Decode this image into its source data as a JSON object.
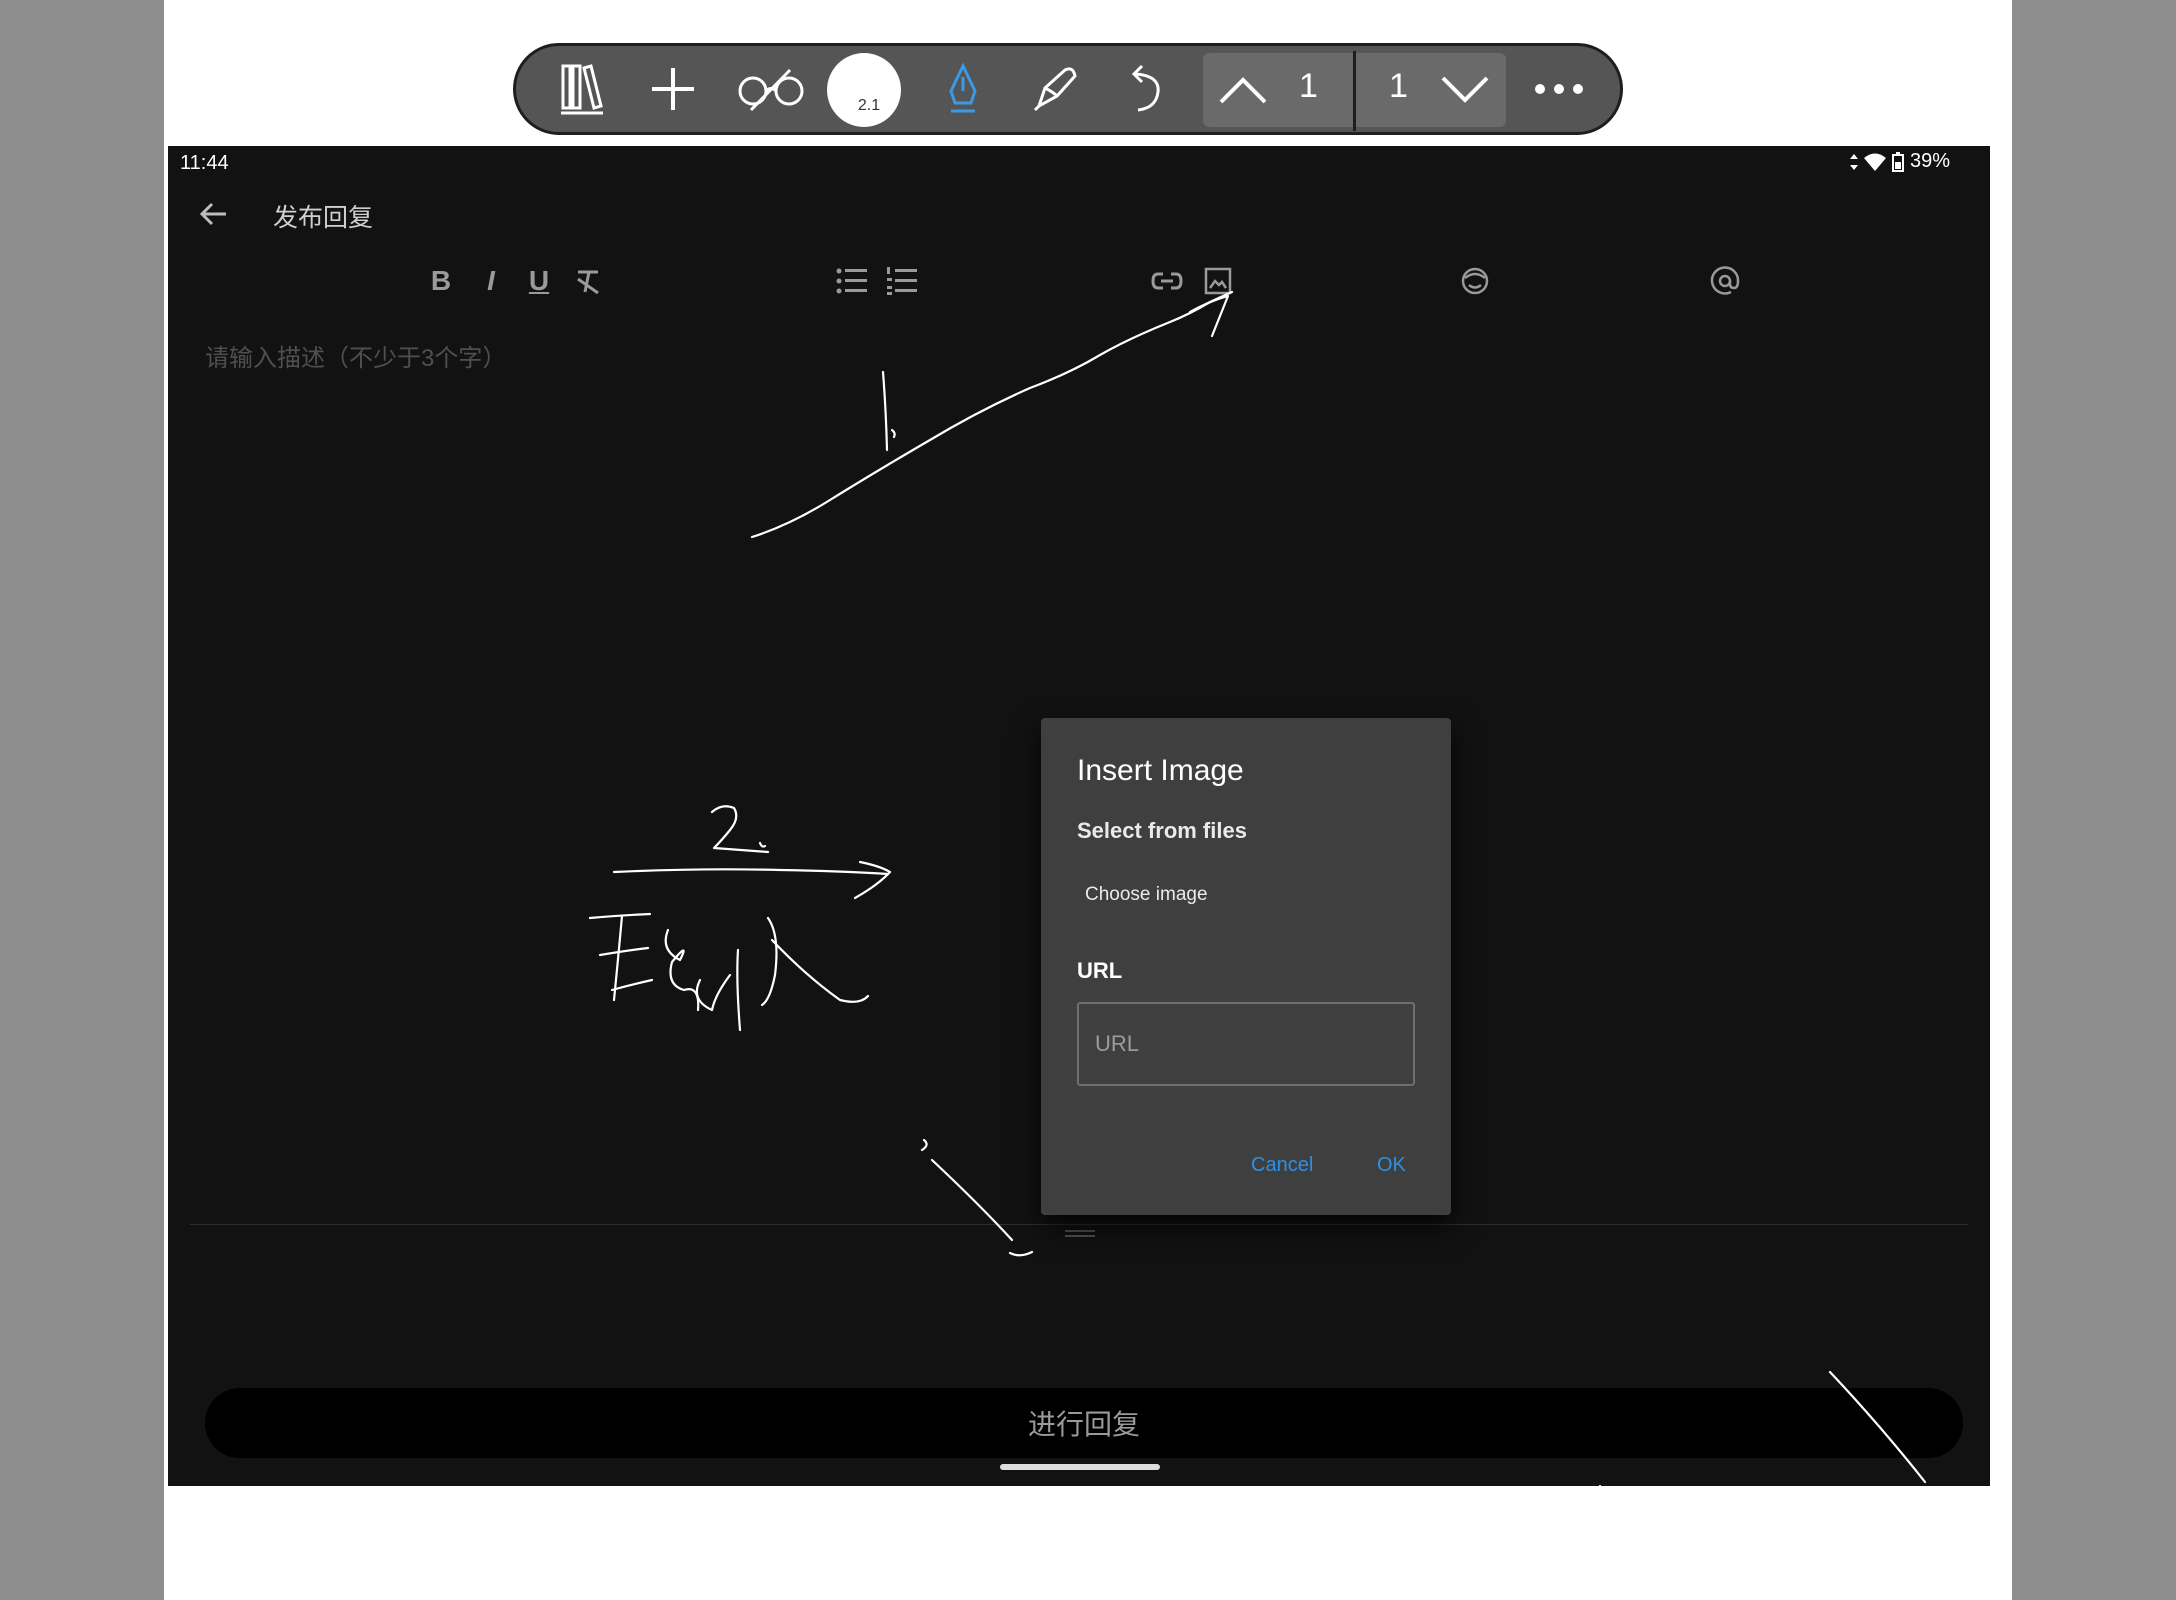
{
  "toolbar": {
    "icons": [
      "library-icon",
      "plus-icon",
      "glasses-icon",
      "size-picker",
      "pen-icon",
      "eraser-icon",
      "undo-icon",
      "page-up-icon",
      "page-down-icon",
      "more-icon"
    ],
    "pen_size": "2.1",
    "current_page": "1",
    "total_pages": "1"
  },
  "status_bar": {
    "time": "11:44",
    "battery": "39%"
  },
  "app_bar": {
    "title": "发布回复"
  },
  "editor": {
    "tools": {
      "bold": "B",
      "italic": "I",
      "underline": "U"
    },
    "placeholder": "请输入描述（不少于3个字）"
  },
  "dialog": {
    "title": "Insert Image",
    "subtitle": "Select from files",
    "choose_label": "Choose image",
    "url_label": "URL",
    "url_placeholder": "URL",
    "url_value": "",
    "cancel_label": "Cancel",
    "ok_label": "OK"
  },
  "submit_label": "进行回复",
  "colors": {
    "accent": "#2d8fe6",
    "screen_bg": "#121212",
    "dialog_bg": "#3f3f3f",
    "toolbar_bg": "#555555"
  }
}
